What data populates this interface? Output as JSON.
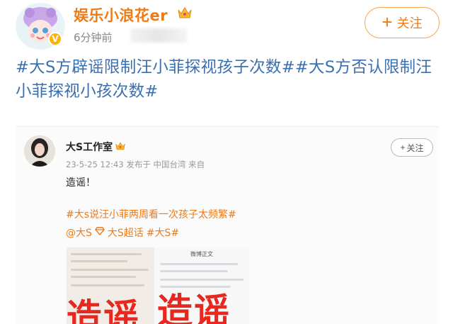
{
  "post": {
    "username": "娱乐小浪花er",
    "timestamp": "6分钟前",
    "follow_label": "关注",
    "text": "#大S方辟谣限制汪小菲探视孩子次数##大S方否认限制汪小菲探视小孩次数#"
  },
  "repost": {
    "username": "大S工作室",
    "meta": "23-5-25 12:43  发布于 中国台湾  来自",
    "follow_label": "关注",
    "text": "造谣！",
    "tag1": "#大s说汪小菲两周看一次孩子太频繁#",
    "tag2_a": "@大S",
    "tag2_b": "大S超话",
    "tag2_c": "#大S#",
    "thumb_right_title": "微博正文",
    "stamp_text": "造谣"
  },
  "icons": [
    "crown-icon",
    "verified-icon",
    "plus-icon",
    "diamond-icon"
  ],
  "colors": {
    "username": "#f07a13",
    "hashtag": "#3a6fb0",
    "stamp": "#e8271f"
  }
}
